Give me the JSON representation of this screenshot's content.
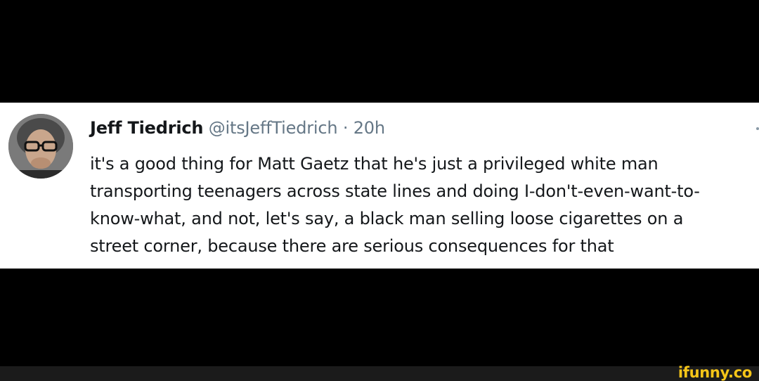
{
  "tweet": {
    "author_name": "Jeff Tiedrich",
    "author_handle": "@itsJeffTiedrich",
    "separator": "·",
    "timestamp": "20h",
    "text_lines": [
      "it's a good thing for Matt Gaetz that he's just a privileged white man",
      "transporting teenagers across state lines and doing I-don't-even-want-to-",
      "know-what, and not, let's say, a black man selling loose cigarettes on a",
      "street corner, because there are serious consequences for that"
    ]
  },
  "watermark": {
    "text": "ifunny.co"
  },
  "colors": {
    "background": "#000000",
    "card": "#ffffff",
    "text": "#14171a",
    "muted": "#657786",
    "watermark": "#f5c518"
  }
}
